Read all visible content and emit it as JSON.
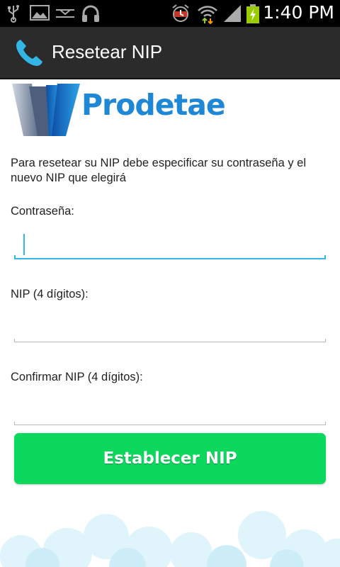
{
  "status_bar": {
    "time": "1:40 PM",
    "icons": [
      "usb-icon",
      "image-icon",
      "voicemail-icon",
      "headset-icon",
      "alarm-icon",
      "wifi-icon",
      "signal-icon",
      "battery-charging-icon"
    ]
  },
  "action_bar": {
    "app_icon": "phone-icon",
    "title": "Resetear NIP"
  },
  "logo": {
    "brand": "Prodetae"
  },
  "form": {
    "description": "Para resetear su NIP debe especificar su contraseña y el nuevo NIP que elegirá",
    "password_label": "Contraseña:",
    "password_value": "",
    "nip_label": "NIP (4 dígitos):",
    "nip_value": "",
    "confirm_label": "Confirmar NIP (4 dígitos):",
    "confirm_value": "",
    "submit_label": "Establecer NIP"
  },
  "colors": {
    "accent": "#33b5e5",
    "button": "#0cd85e",
    "brand": "#1e87d6",
    "action_bar": "#2b2b2b"
  }
}
